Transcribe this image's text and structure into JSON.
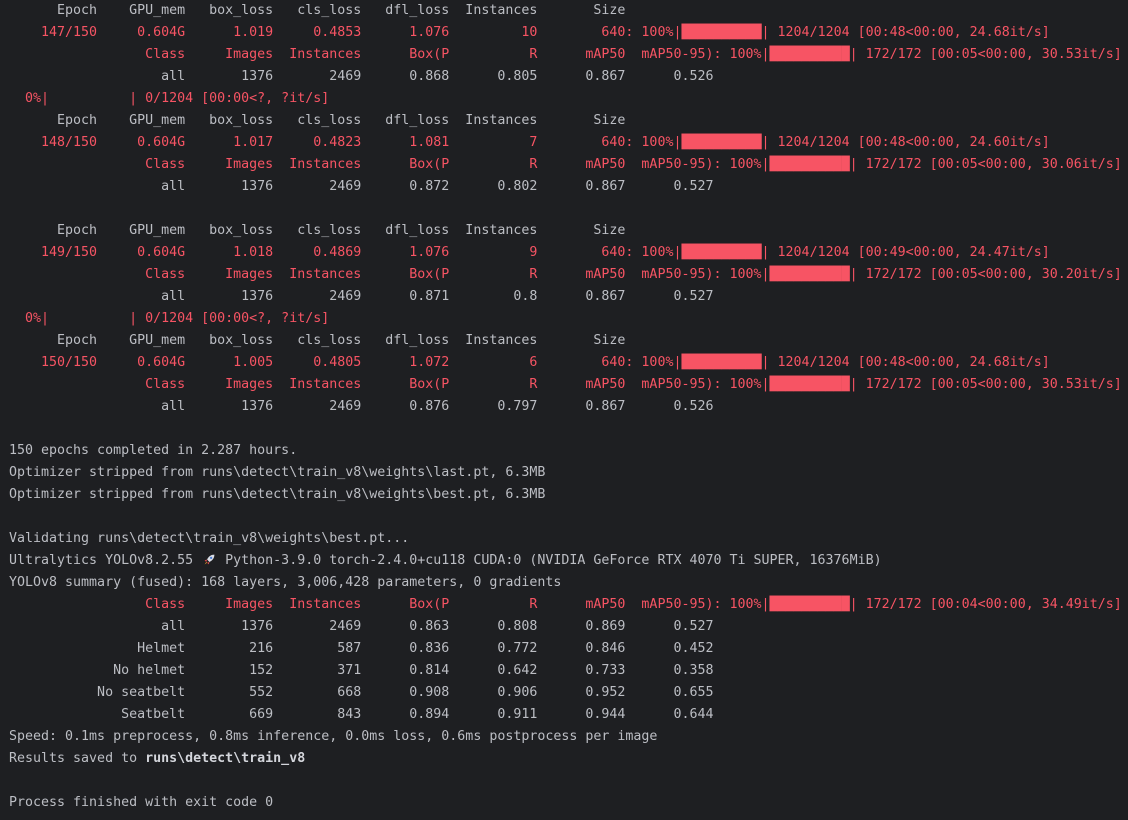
{
  "colors": {
    "background": "#1e1f22",
    "text": "#bcbec4",
    "error_red": "#f75464"
  },
  "lines": [
    [
      {
        "k": "g",
        "t": "      Epoch    GPU_mem   box_loss   cls_loss   dfl_loss  Instances       Size"
      }
    ],
    [
      {
        "k": "r",
        "t": "    147/150     0.604G      1.019     0.4853      1.076         10        640: 100%|"
      },
      {
        "k": "bar",
        "t": "██████████"
      },
      {
        "k": "r",
        "t": "| 1204/1204 [00:48<00:00, 24.68it/s]"
      }
    ],
    [
      {
        "k": "r",
        "t": "                 Class     Images  Instances      Box(P          R      mAP50  mAP50-95): 100%|"
      },
      {
        "k": "bar",
        "t": "██████████"
      },
      {
        "k": "r",
        "t": "| 172/172 [00:05<00:00, 30.53it/s]"
      }
    ],
    [
      {
        "k": "g",
        "t": "                   all       1376       2469      0.868      0.805      0.867      0.526"
      }
    ],
    [
      {
        "k": "r",
        "t": "  0%|          | 0/1204 [00:00<?, ?it/s]"
      }
    ],
    [
      {
        "k": "g",
        "t": "      Epoch    GPU_mem   box_loss   cls_loss   dfl_loss  Instances       Size"
      }
    ],
    [
      {
        "k": "r",
        "t": "    148/150     0.604G      1.017     0.4823      1.081          7        640: 100%|"
      },
      {
        "k": "bar",
        "t": "██████████"
      },
      {
        "k": "r",
        "t": "| 1204/1204 [00:48<00:00, 24.60it/s]"
      }
    ],
    [
      {
        "k": "r",
        "t": "                 Class     Images  Instances      Box(P          R      mAP50  mAP50-95): 100%|"
      },
      {
        "k": "bar",
        "t": "██████████"
      },
      {
        "k": "r",
        "t": "| 172/172 [00:05<00:00, 30.06it/s]"
      }
    ],
    [
      {
        "k": "g",
        "t": "                   all       1376       2469      0.872      0.802      0.867      0.527"
      }
    ],
    [],
    [
      {
        "k": "g",
        "t": "      Epoch    GPU_mem   box_loss   cls_loss   dfl_loss  Instances       Size"
      }
    ],
    [
      {
        "k": "r",
        "t": "    149/150     0.604G      1.018     0.4869      1.076          9        640: 100%|"
      },
      {
        "k": "bar",
        "t": "██████████"
      },
      {
        "k": "r",
        "t": "| 1204/1204 [00:49<00:00, 24.47it/s]"
      }
    ],
    [
      {
        "k": "r",
        "t": "                 Class     Images  Instances      Box(P          R      mAP50  mAP50-95): 100%|"
      },
      {
        "k": "bar",
        "t": "██████████"
      },
      {
        "k": "r",
        "t": "| 172/172 [00:05<00:00, 30.20it/s]"
      }
    ],
    [
      {
        "k": "g",
        "t": "                   all       1376       2469      0.871        0.8      0.867      0.527"
      }
    ],
    [
      {
        "k": "r",
        "t": "  0%|          | 0/1204 [00:00<?, ?it/s]"
      }
    ],
    [
      {
        "k": "g",
        "t": "      Epoch    GPU_mem   box_loss   cls_loss   dfl_loss  Instances       Size"
      }
    ],
    [
      {
        "k": "r",
        "t": "    150/150     0.604G      1.005     0.4805      1.072          6        640: 100%|"
      },
      {
        "k": "bar",
        "t": "██████████"
      },
      {
        "k": "r",
        "t": "| 1204/1204 [00:48<00:00, 24.68it/s]"
      }
    ],
    [
      {
        "k": "r",
        "t": "                 Class     Images  Instances      Box(P          R      mAP50  mAP50-95): 100%|"
      },
      {
        "k": "bar",
        "t": "██████████"
      },
      {
        "k": "r",
        "t": "| 172/172 [00:05<00:00, 30.53it/s]"
      }
    ],
    [
      {
        "k": "g",
        "t": "                   all       1376       2469      0.876      0.797      0.867      0.526"
      }
    ],
    [],
    [
      {
        "k": "g",
        "t": "150 epochs completed in 2.287 hours."
      }
    ],
    [
      {
        "k": "g",
        "t": "Optimizer stripped from runs\\detect\\train_v8\\weights\\last.pt, 6.3MB"
      }
    ],
    [
      {
        "k": "g",
        "t": "Optimizer stripped from runs\\detect\\train_v8\\weights\\best.pt, 6.3MB"
      }
    ],
    [],
    [
      {
        "k": "g",
        "t": "Validating runs\\detect\\train_v8\\weights\\best.pt..."
      }
    ],
    [
      {
        "k": "g",
        "t": "Ultralytics YOLOv8.2.55 "
      },
      {
        "k": "icon",
        "icon": "rocket-icon"
      },
      {
        "k": "g",
        "t": " Python-3.9.0 torch-2.4.0+cu118 CUDA:0 (NVIDIA GeForce RTX 4070 Ti SUPER, 16376MiB)"
      }
    ],
    [
      {
        "k": "g",
        "t": "YOLOv8 summary (fused): 168 layers, 3,006,428 parameters, 0 gradients"
      }
    ],
    [
      {
        "k": "r",
        "t": "                 Class     Images  Instances      Box(P          R      mAP50  mAP50-95): 100%|"
      },
      {
        "k": "bar",
        "t": "██████████"
      },
      {
        "k": "r",
        "t": "| 172/172 [00:04<00:00, 34.49it/s]"
      }
    ],
    [
      {
        "k": "g",
        "t": "                   all       1376       2469      0.863      0.808      0.869      0.527"
      }
    ],
    [
      {
        "k": "g",
        "t": "                Helmet        216        587      0.836      0.772      0.846      0.452"
      }
    ],
    [
      {
        "k": "g",
        "t": "             No helmet        152        371      0.814      0.642      0.733      0.358"
      }
    ],
    [
      {
        "k": "g",
        "t": "           No seatbelt        552        668      0.908      0.906      0.952      0.655"
      }
    ],
    [
      {
        "k": "g",
        "t": "              Seatbelt        669        843      0.894      0.911      0.944      0.644"
      }
    ],
    [
      {
        "k": "g",
        "t": "Speed: 0.1ms preprocess, 0.8ms inference, 0.0ms loss, 0.6ms postprocess per image"
      }
    ],
    [
      {
        "k": "g",
        "t": "Results saved to "
      },
      {
        "k": "b",
        "t": "runs\\detect\\train_v8"
      }
    ],
    [],
    [
      {
        "k": "g",
        "t": "Process finished with exit code 0"
      }
    ]
  ]
}
